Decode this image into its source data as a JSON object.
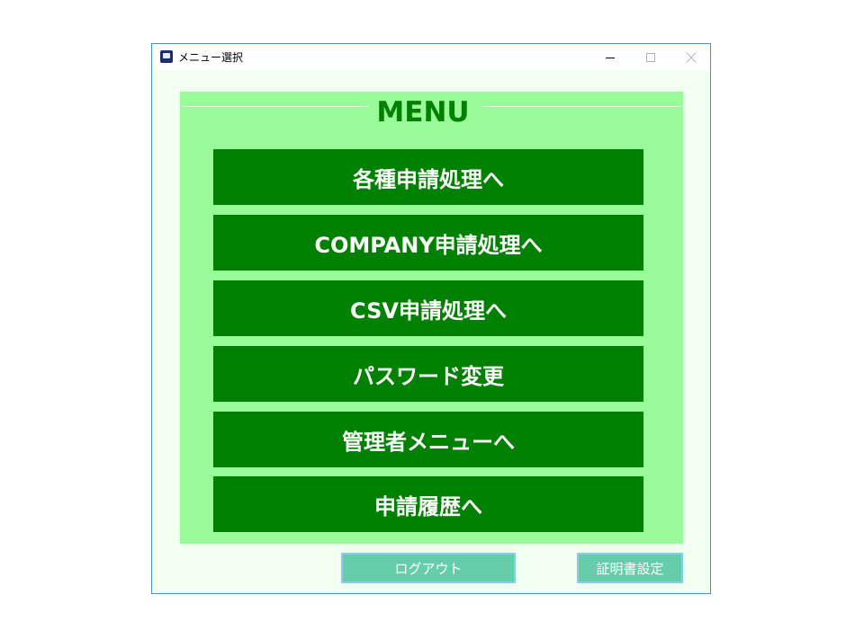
{
  "window": {
    "title": "メニュー選択",
    "controls": [
      "minimize",
      "maximize",
      "close"
    ]
  },
  "menu": {
    "title": "MENU",
    "items": [
      {
        "label": "各種申請処理へ"
      },
      {
        "label": "COMPANY申請処理へ"
      },
      {
        "label": "CSV申請処理へ"
      },
      {
        "label": "パスワード変更"
      },
      {
        "label": "管理者メニューへ"
      },
      {
        "label": "申請履歴へ"
      }
    ]
  },
  "footer": {
    "logout_label": "ログアウト",
    "cert_label": "証明書設定"
  },
  "colors": {
    "background": "#f0fff0",
    "panel": "#98fb98",
    "button": "#008000",
    "footer_button": "#66cdaa",
    "footer_border": "#87ceeb"
  }
}
